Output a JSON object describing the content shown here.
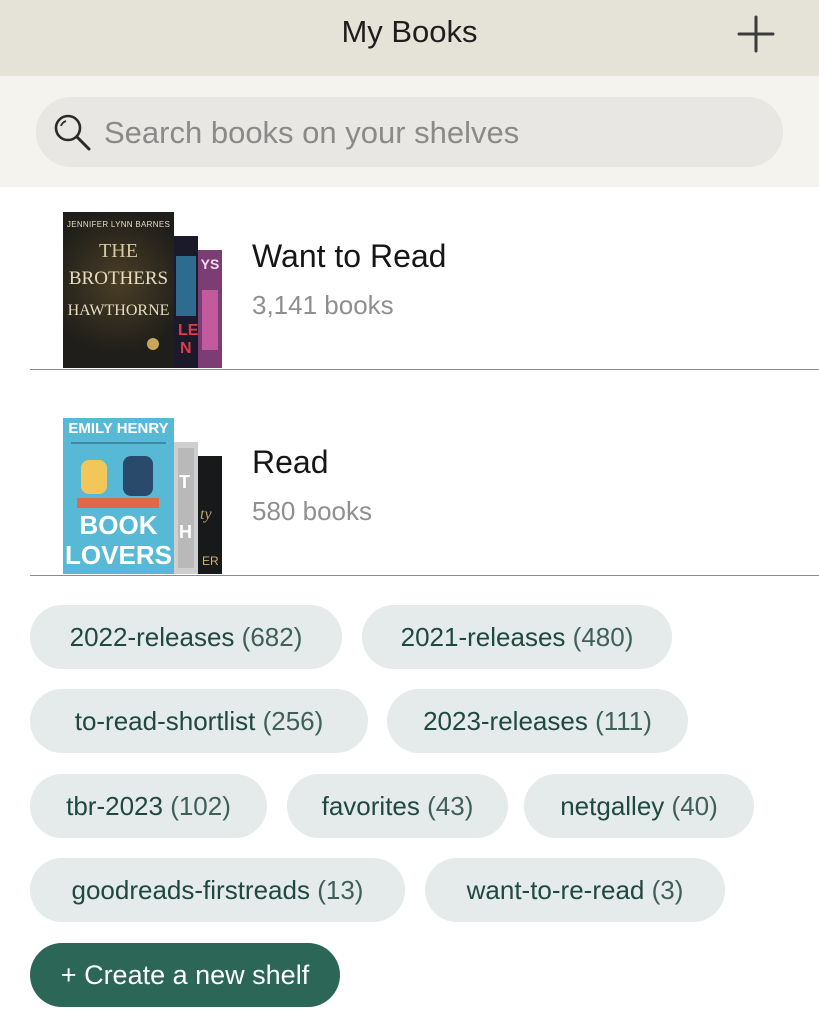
{
  "header": {
    "title": "My Books",
    "add_icon": "plus-icon"
  },
  "search": {
    "placeholder": "Search books on your shelves",
    "value": "",
    "icon": "magnifier-icon"
  },
  "shelves": [
    {
      "title": "Want to Read",
      "count": "3,141 books",
      "covers": [
        {
          "author": "JENNIFER LYNN BARNES",
          "line1": "THE",
          "line2": "BROTHERS",
          "line3": "HAWTHORNE"
        }
      ]
    },
    {
      "title": "Read",
      "count": "580 books",
      "covers": [
        {
          "author": "EMILY HENRY",
          "line1": "BOOK",
          "line2": "LOVERS"
        }
      ]
    }
  ],
  "custom_shelves": [
    {
      "name": "2022-releases",
      "count": "(682)"
    },
    {
      "name": "2021-releases",
      "count": "(480)"
    },
    {
      "name": "to-read-shortlist",
      "count": "(256)"
    },
    {
      "name": "2023-releases",
      "count": "(111)"
    },
    {
      "name": "tbr-2023",
      "count": "(102)"
    },
    {
      "name": "favorites",
      "count": "(43)"
    },
    {
      "name": "netgalley",
      "count": "(40)"
    },
    {
      "name": "goodreads-firstreads",
      "count": "(13)"
    },
    {
      "name": "want-to-re-read",
      "count": "(3)"
    }
  ],
  "create_button": {
    "label": "+ Create a new shelf"
  },
  "colors": {
    "header_bg": "#e5e2d7",
    "accent": "#2b6656",
    "tag_bg": "#e4ebea"
  }
}
